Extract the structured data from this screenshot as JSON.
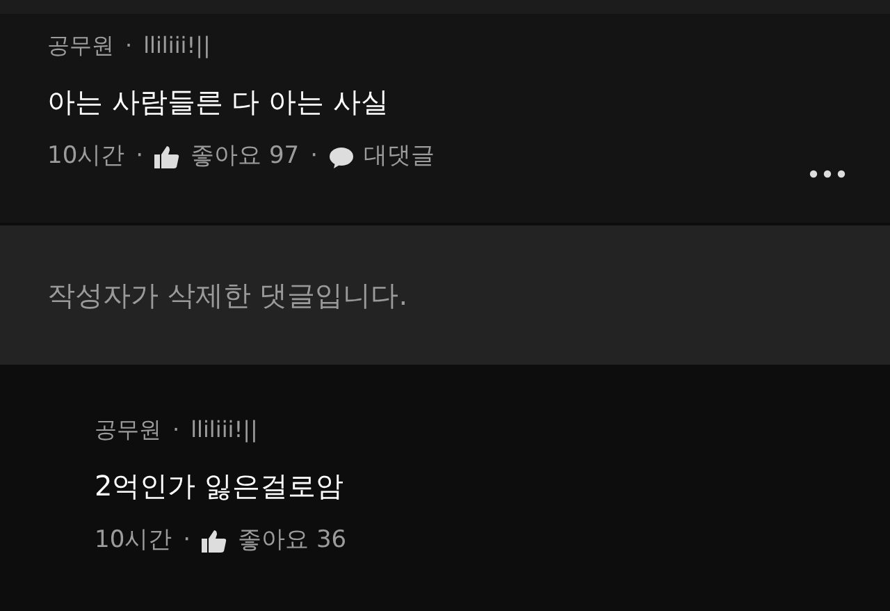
{
  "comments": [
    {
      "kind": "comment",
      "reply": false,
      "author": "공무원",
      "separator": "·",
      "handle": "lliliii!||",
      "text": "아는 사람들른 다 아는 사실",
      "time": "10시간",
      "likes": "좋아요 97",
      "reply_label": "대댓글",
      "more": true
    },
    {
      "kind": "deleted",
      "text": "작성자가 삭제한 댓글입니다."
    },
    {
      "kind": "comment",
      "reply": true,
      "author": "공무원",
      "separator": "·",
      "handle": "lliliii!||",
      "text": "2억인가 잃은걸로암",
      "time": "10시간",
      "likes": "좋아요 36",
      "more": false
    }
  ]
}
